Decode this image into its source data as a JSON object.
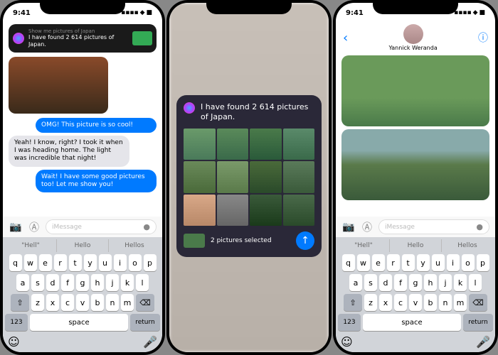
{
  "status": {
    "time": "9:41",
    "signal": "▪▪▪▪",
    "wifi": "◆",
    "battery": "■"
  },
  "p1": {
    "siri": {
      "query": "Show me pictures of Japan",
      "response": "I have found 2 614 pictures of Japan."
    },
    "m1": "OMG! This picture is so cool!",
    "m2": "Yeah! I know, right? I took it when I was heading home. The light was incredible that night!",
    "m3": "Wait! I have some good pictures too! Let me show you!",
    "placeholder": "iMessage"
  },
  "p2": {
    "title": "I have found 2 614 pictures of Japan.",
    "selected": "2 pictures selected"
  },
  "p3": {
    "contact": "Yannick Weranda",
    "placeholder": "iMessage"
  },
  "kbd": {
    "sug": [
      "\"Hell\"",
      "Hello",
      "Hellos"
    ],
    "r1": [
      "q",
      "w",
      "e",
      "r",
      "t",
      "y",
      "u",
      "i",
      "o",
      "p"
    ],
    "r2": [
      "a",
      "s",
      "d",
      "f",
      "g",
      "h",
      "j",
      "k",
      "l"
    ],
    "r3": [
      "z",
      "x",
      "c",
      "v",
      "b",
      "n",
      "m"
    ],
    "shift": "⇧",
    "del": "⌫",
    "num": "123",
    "space": "space",
    "ret": "return",
    "emoji": "☺",
    "mic": "🎤"
  }
}
